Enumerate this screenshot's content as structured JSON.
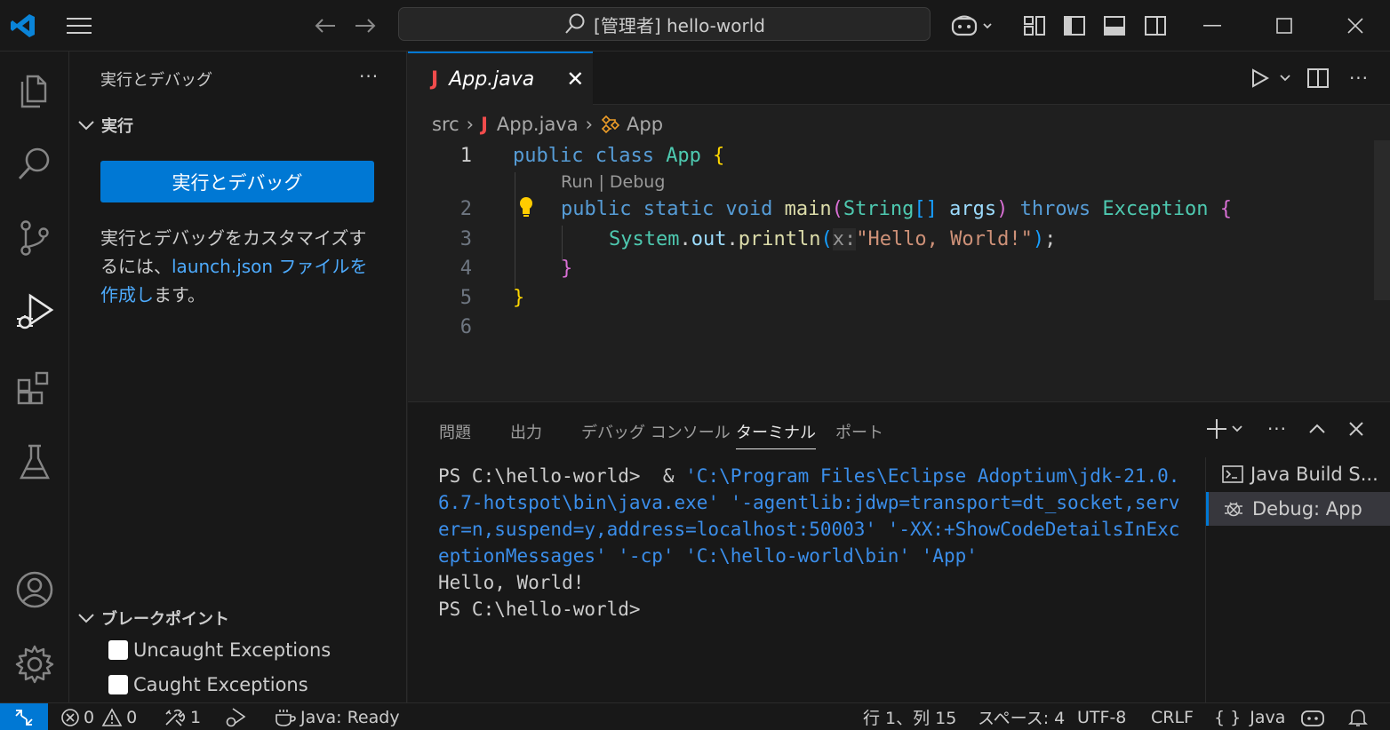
{
  "titlebar": {
    "search_text": "[管理者] hello-world"
  },
  "sidebar": {
    "title": "実行とデバッグ",
    "more": "···",
    "run_section": "実行",
    "run_button": "実行とデバッグ",
    "desc_before": "実行とデバッグをカスタマイズするには、",
    "desc_link": "launch.json ファイルを作成し",
    "desc_after": "ます。",
    "breakpoints_section": "ブレークポイント",
    "breakpoints": [
      {
        "label": "Uncaught Exceptions",
        "checked": false
      },
      {
        "label": "Caught Exceptions",
        "checked": false
      }
    ]
  },
  "editor": {
    "tab_icon": "J",
    "tab_label": "App.java",
    "breadcrumb": {
      "folder": "src",
      "file": "App.java",
      "symbol": "App"
    },
    "codelens": "Run | Debug",
    "line_numbers": [
      "1",
      "2",
      "3",
      "4",
      "5",
      "6"
    ],
    "code": {
      "l1_kw": "public class ",
      "l1_cls": "App",
      "l1_br": " {",
      "l2_kw1": "public static void ",
      "l2_fn": "main",
      "l2_p1": "(",
      "l2_cls": "String",
      "l2_arr": "[]",
      "l2_var": " args",
      "l2_p2": ")",
      "l2_kw2": " throws ",
      "l2_exc": "Exception",
      "l2_br": " {",
      "l3_cls": "System",
      "l3_dot1": ".",
      "l3_var": "out",
      "l3_dot2": ".",
      "l3_fn": "println",
      "l3_p1": "(",
      "l3_hint": "x:",
      "l3_str": "\"Hello, World!\"",
      "l3_p2": ")",
      "l3_end": ";",
      "l4_br": "}",
      "l5_br": "}"
    }
  },
  "panel": {
    "tabs": [
      "問題",
      "出力",
      "デバッグ コンソール",
      "ターミナル",
      "ポート"
    ],
    "active_tab": "ターミナル",
    "terminal": {
      "prompt1": "PS C:\\hello-world>  & ",
      "cmd_str": "'C:\\Program Files\\Eclipse Adoptium\\jdk-21.0.6.7-hotspot\\bin\\java.exe' '-agentlib:jdwp=transport=dt_socket,server=n,suspend=y,address=localhost:50003' '-XX:+ShowCodeDetailsInExceptionMessages' '-cp' 'C:\\hello-world\\bin' 'App'",
      "output": "Hello, World!",
      "prompt2": "PS C:\\hello-world>"
    },
    "terminal_list": [
      {
        "label": "Java Build S...",
        "icon": "terminal-icon"
      },
      {
        "label": "Debug: App",
        "icon": "debug-icon"
      }
    ]
  },
  "statusbar": {
    "errors": "0",
    "warnings": "0",
    "ports": "1",
    "java_status": "Java: Ready",
    "position": "行 1、列 15",
    "spaces": "スペース: 4",
    "encoding": "UTF-8",
    "eol": "CRLF",
    "language_icon": "{ }",
    "language": "Java"
  },
  "colors": {
    "accent": "#0078d4",
    "link": "#4daafc",
    "java_icon": "#f14c4c"
  }
}
